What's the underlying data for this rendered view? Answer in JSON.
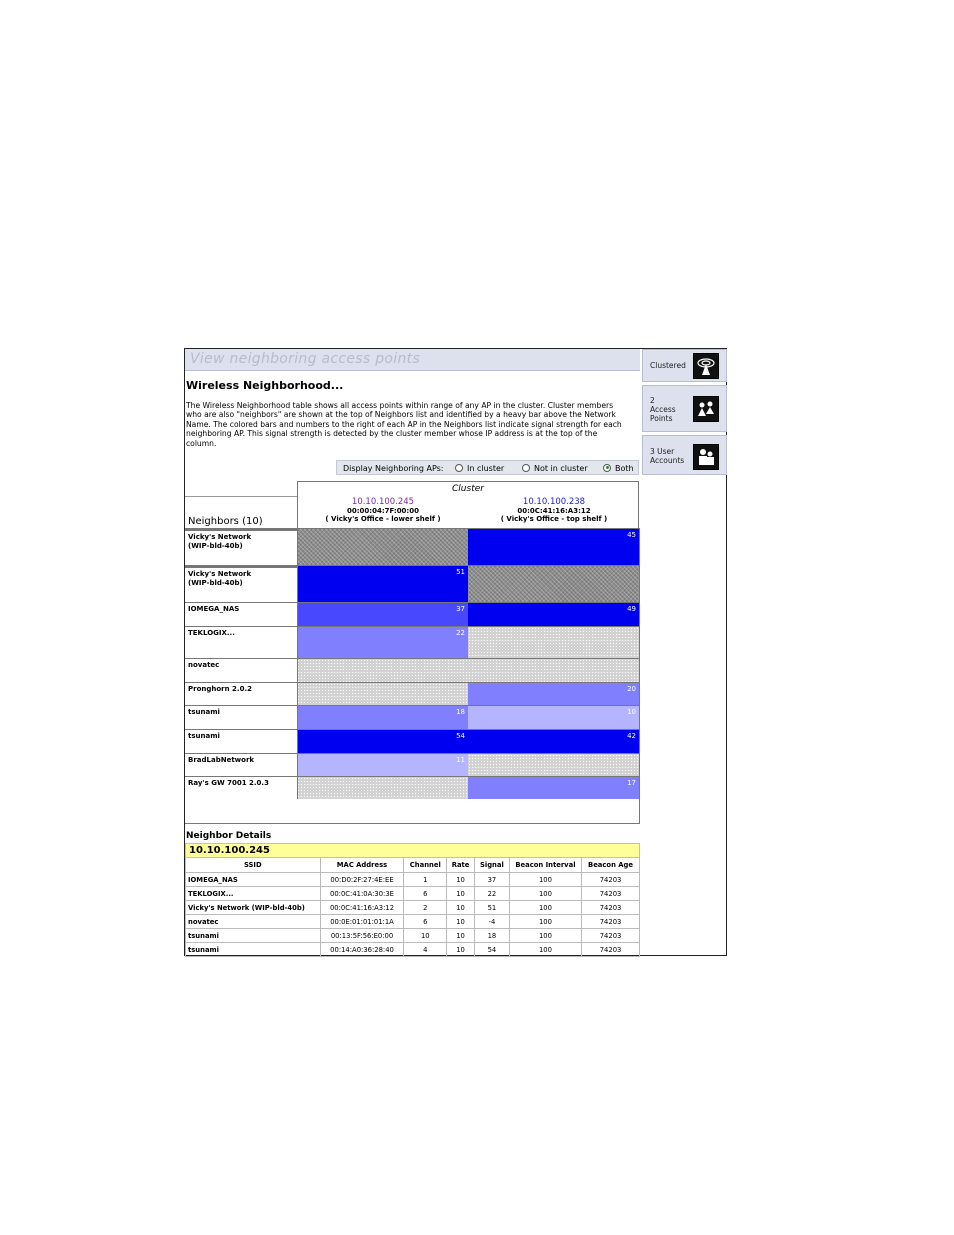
{
  "title": "View neighboring access points",
  "heading": "Wireless Neighborhood...",
  "intro": "The Wireless Neighborhood table shows all access points within range of any AP in the cluster. Cluster members who are also \"neighbors\" are shown at the top of Neighbors list and identified by a heavy bar above the Network Name. The colored bars and numbers to the right of each AP in the Neighbors list indicate signal strength for each neighboring AP. This signal strength is detected by the cluster member whose IP address is at the top of the column.",
  "filter": {
    "label": "Display Neighboring APs:",
    "options": [
      "In cluster",
      "Not in cluster",
      "Both"
    ],
    "selected": "Both"
  },
  "neighbors_title": "Neighbors (10)",
  "cluster": {
    "title": "Cluster",
    "members": [
      {
        "ip": "10.10.100.245",
        "mac": "00:00:04:7F:00:00",
        "location": "( Vicky's Office - lower shelf )"
      },
      {
        "ip": "10.10.100.238",
        "mac": "00:0C:41:16:A3:12",
        "location": "( Vicky's Office - top shelf )"
      }
    ]
  },
  "neighbors": [
    {
      "name": "Vicky's Network\n(WIP-bld-40b)",
      "signals": [
        null,
        45
      ],
      "self": 0
    },
    {
      "name": "Vicky's Network\n(WIP-bld-40b)",
      "signals": [
        51,
        null
      ],
      "self": 1
    },
    {
      "name": "IOMEGA_NAS",
      "signals": [
        37,
        49
      ]
    },
    {
      "name": "TEKLOGIX...",
      "signals": [
        22,
        null
      ]
    },
    {
      "name": "novatec",
      "signals": [
        null,
        null
      ]
    },
    {
      "name": "Pronghorn 2.0.2",
      "signals": [
        null,
        20
      ]
    },
    {
      "name": "tsunami",
      "signals": [
        18,
        10
      ]
    },
    {
      "name": "tsunami",
      "signals": [
        54,
        42
      ]
    },
    {
      "name": "BradLabNetwork",
      "signals": [
        11,
        null
      ]
    },
    {
      "name": "Ray's GW 7001 2.0.3",
      "signals": [
        null,
        17
      ]
    }
  ],
  "details": {
    "title": "Neighbor Details",
    "ip": "10.10.100.245",
    "columns": [
      "SSID",
      "MAC Address",
      "Channel",
      "Rate",
      "Signal",
      "Beacon Interval",
      "Beacon Age"
    ],
    "rows": [
      [
        "IOMEGA_NAS",
        "00:D0:2F:27:4E:EE",
        "1",
        "10",
        "37",
        "100",
        "74203"
      ],
      [
        "TEKLOGIX...",
        "00:0C:41:0A:30:3E",
        "6",
        "10",
        "22",
        "100",
        "74203"
      ],
      [
        "Vicky's Network (WIP-bld-40b)",
        "00:0C:41:16:A3:12",
        "2",
        "10",
        "51",
        "100",
        "74203"
      ],
      [
        "novatec",
        "00:0E:01:01:01:1A",
        "6",
        "10",
        "-4",
        "100",
        "74203"
      ],
      [
        "tsunami",
        "00:13:5F:56:E0:00",
        "10",
        "10",
        "18",
        "100",
        "74203"
      ],
      [
        "tsunami",
        "00:14:A0:36:28:40",
        "4",
        "10",
        "54",
        "100",
        "74203"
      ]
    ]
  },
  "sidebar": [
    {
      "label": "Clustered",
      "icon": "cluster-antenna-icon"
    },
    {
      "label": "2\nAccess\nPoints",
      "icon": "access-points-icon"
    },
    {
      "label": "3 User\nAccounts",
      "icon": "user-accounts-icon"
    }
  ],
  "colors": {
    "strong": "#0000f0",
    "medium": "#4848ff",
    "weak": "#8080ff",
    "faint": "#b4b4ff"
  }
}
